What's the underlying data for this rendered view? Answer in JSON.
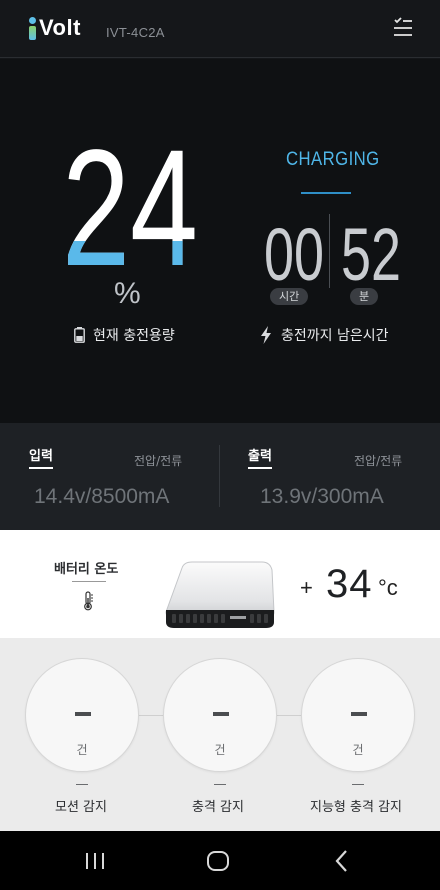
{
  "header": {
    "logo_text": "Volt",
    "model": "IVT-4C2A",
    "menu_icon": "checklist-menu-icon"
  },
  "charge": {
    "percent": 24,
    "percent_sign": "%",
    "capacity_label": "현재 충전용량",
    "status": "CHARGING",
    "hours": "00",
    "minutes": "52",
    "hours_unit": "시간",
    "minutes_unit": "분",
    "remaining_label": "충전까지 남은시간"
  },
  "io": {
    "input": {
      "title": "입력",
      "sub": "전압/전류",
      "value": "14.4v/8500mA"
    },
    "output": {
      "title": "출력",
      "sub": "전압/전류",
      "value": "13.9v/300mA"
    }
  },
  "temperature": {
    "label": "배터리 온도",
    "sign": "+",
    "value": "34",
    "unit": "°c"
  },
  "sensors": [
    {
      "count": "–",
      "unit": "건",
      "label": "모션 감지"
    },
    {
      "count": "–",
      "unit": "건",
      "label": "충격 감지"
    },
    {
      "count": "–",
      "unit": "건",
      "label": "지능형 충격 감지"
    }
  ],
  "colors": {
    "accent_blue": "#4fb6e8",
    "fill_blue": "#5ab9ea",
    "dark_bg": "#0f1113",
    "io_bg": "#1e2125"
  }
}
